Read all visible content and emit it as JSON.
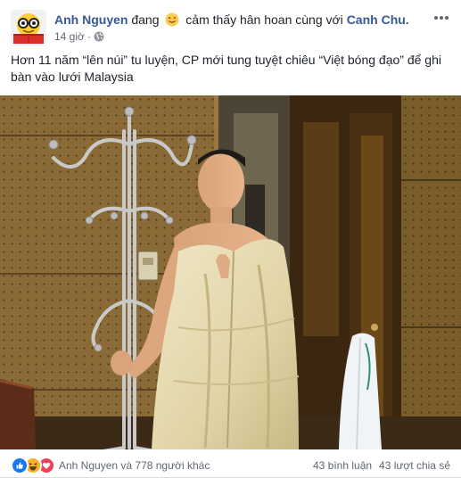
{
  "post": {
    "author": "Anh Nguyen",
    "feeling_prefix": "đang",
    "feeling_emoji": "smiling-face",
    "feeling_text": "cảm thấy hân hoan cùng với",
    "tagged_page": "Canh Chu.",
    "timestamp": "14 giờ",
    "separator": "·",
    "privacy_icon": "globe-icon",
    "more_icon": "ellipsis-icon",
    "text": "Hơn 11 năm “lên núi” tu luyện, CP mới tung tuyệt chiêu “Việt bóng đạo” để ghi bàn vào lưới Malaysia"
  },
  "photo": {
    "subject": "man wrapped in cream blanket standing next to chrome coat rack"
  },
  "footer": {
    "reaction_icons": [
      "like-icon",
      "haha-icon",
      "love-icon"
    ],
    "reaction_summary": "Anh Nguyen và 778 người khác",
    "comments": "43 bình luận",
    "shares": "43 lượt chia sẻ"
  },
  "colors": {
    "link": "#385898",
    "text": "#1d2129",
    "secondary": "#616770",
    "like": "#1877f2",
    "haha": "#f7b125",
    "love": "#f33e58"
  }
}
